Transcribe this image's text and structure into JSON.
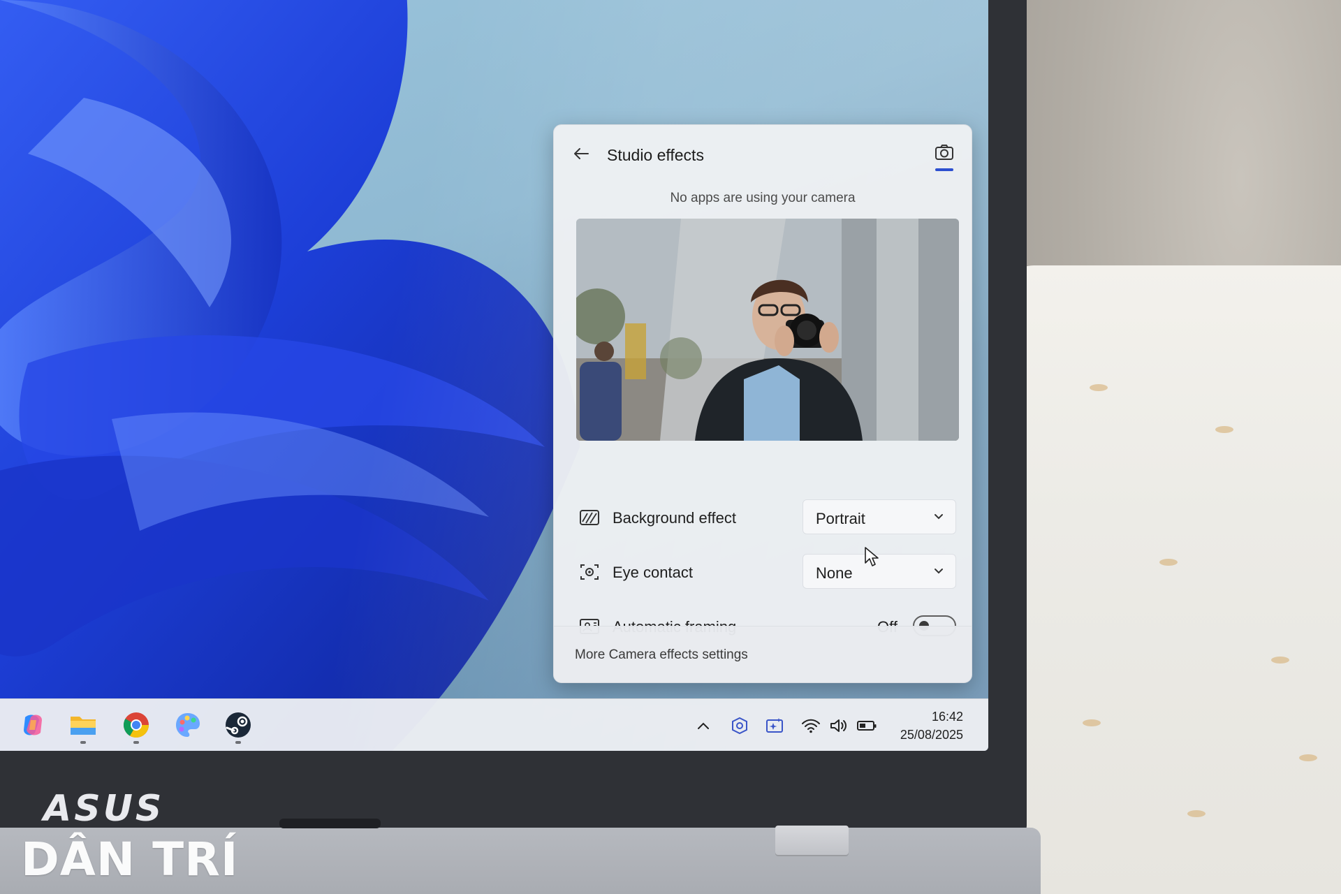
{
  "panel": {
    "title": "Studio effects",
    "camera_status": "No apps are using your camera",
    "settings": {
      "background_effect": {
        "label": "Background effect",
        "value": "Portrait"
      },
      "eye_contact": {
        "label": "Eye contact",
        "value": "None"
      },
      "automatic_framing": {
        "label": "Automatic framing",
        "state_label": "Off"
      }
    },
    "footer_link": "More Camera effects settings",
    "accent_color": "#2c4fcf"
  },
  "taskbar": {
    "apps": [
      "copilot-icon",
      "file-explorer-icon",
      "chrome-icon",
      "paint-icon",
      "steam-icon"
    ],
    "tray": [
      "chevron-up-icon",
      "shield-icon",
      "studio-effects-icon",
      "wifi-icon",
      "volume-icon",
      "battery-icon"
    ],
    "clock": {
      "time": "16:42",
      "date": "25/08/2025"
    }
  },
  "hardware": {
    "brand": "ASUS"
  },
  "watermark": "DÂN TRÍ"
}
